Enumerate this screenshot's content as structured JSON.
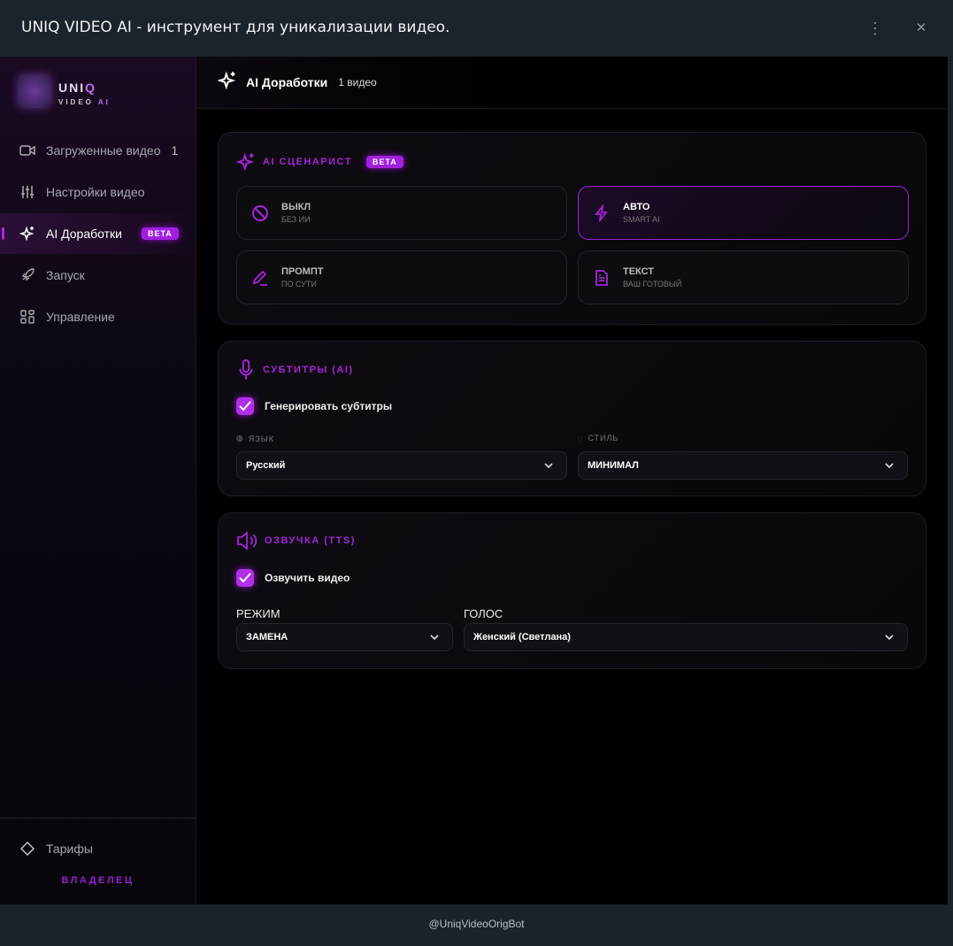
{
  "window": {
    "title": "UNIQ VIDEO AI - инструмент для уникализации видео.",
    "more": "⋮",
    "close": "✕"
  },
  "logo": {
    "t1a": "UNI",
    "t1b": "Q",
    "t2a": "VIDEO ",
    "t2b": "AI"
  },
  "sidebar": {
    "items": [
      {
        "label": "Загруженные видео",
        "count": "1"
      },
      {
        "label": "Настройки видео"
      },
      {
        "label": "AI Доработки",
        "badge": "BETA"
      },
      {
        "label": "Запуск"
      },
      {
        "label": "Управление"
      }
    ],
    "tariffs": "Тарифы",
    "role": "ВЛАДЕЛЕЦ"
  },
  "header": {
    "title": "AI Доработки",
    "count": "1 видео"
  },
  "scenarist": {
    "title": "AI СЦЕНАРИСТ",
    "badge": "BETA",
    "options": [
      {
        "title": "ВЫКЛ",
        "sub": "БЕЗ ИИ"
      },
      {
        "title": "АВТО",
        "sub": "SMART AI"
      },
      {
        "title": "ПРОМПТ",
        "sub": "ПО СУТИ"
      },
      {
        "title": "ТЕКСТ",
        "sub": "ВАШ ГОТОВЫЙ"
      }
    ]
  },
  "subtitles": {
    "title": "СУБТИТРЫ (AI)",
    "checkbox": "Генерировать субтитры",
    "lang_label": "ЯЗЫК",
    "lang_value": "Русский",
    "style_label": "СТИЛЬ",
    "style_value": "МИНИМАЛ"
  },
  "tts": {
    "title": "ОЗВУЧКА (TTS)",
    "checkbox": "Озвучить видео",
    "mode_label": "РЕЖИМ",
    "mode_value": "ЗАМЕНА",
    "voice_label": "ГОЛОС",
    "voice_value": "Женский (Светлана)"
  },
  "footer": {
    "text": "@UniqVideoOrigBot"
  },
  "colors": {
    "accent": "#a524d8"
  }
}
